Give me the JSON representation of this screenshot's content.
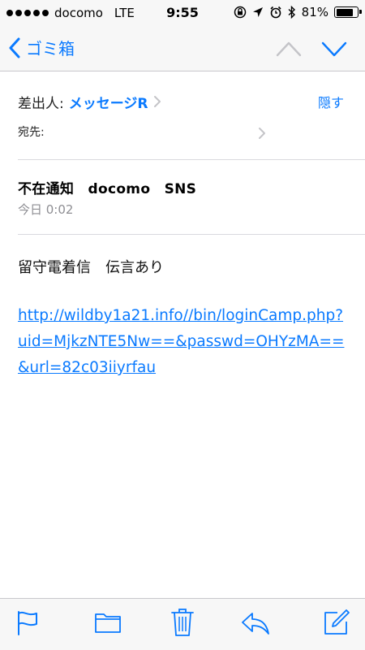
{
  "status_bar": {
    "carrier": "docomo",
    "network": "LTE",
    "time": "9:55",
    "battery_percent": "81%",
    "battery_level": 0.81
  },
  "nav": {
    "back_label": "ゴミ箱"
  },
  "header": {
    "from_label": "差出人:",
    "from_value": "メッセージR",
    "hide_label": "隠す",
    "to_label": "宛先:"
  },
  "message": {
    "subject": "不在通知　docomo　SNS",
    "date": "今日 0:02",
    "body": "留守電着信　伝言あり",
    "link": "http://wildby1a21.info//bin/loginCamp.php?uid=MjkzNTE5Nw==&passwd=OHYzMA==&url=82c03iiyrfau"
  },
  "colors": {
    "accent": "#0a7aff",
    "bar_background": "#f7f7f7",
    "secondary_text": "#8e8e93"
  },
  "icons": {
    "toolbar": [
      "flag-icon",
      "folder-icon",
      "trash-icon",
      "reply-icon",
      "compose-icon"
    ]
  }
}
